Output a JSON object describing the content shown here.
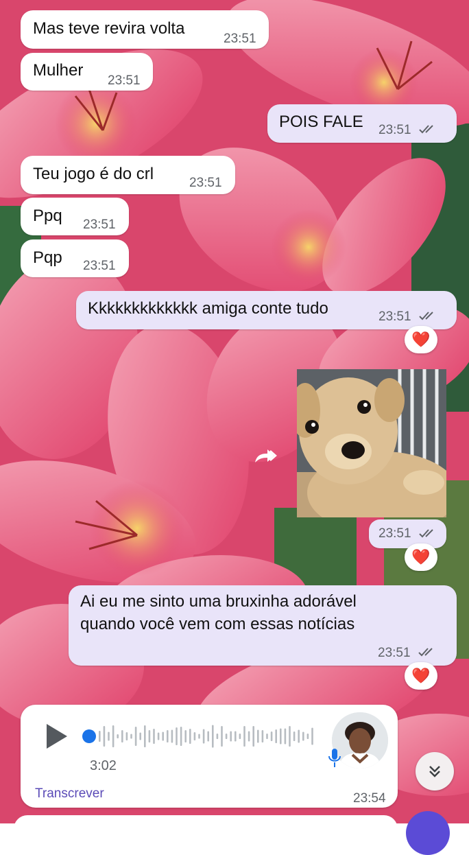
{
  "messages": [
    {
      "text": "Mas teve revira volta",
      "time": "23:51"
    },
    {
      "text": "Mulher",
      "time": "23:51"
    },
    {
      "text": "POIS FALE",
      "time": "23:51"
    },
    {
      "text": "Teu jogo é do crl",
      "time": "23:51"
    },
    {
      "text": "Ppq",
      "time": "23:51"
    },
    {
      "text": "Pqp",
      "time": "23:51"
    },
    {
      "text": "Kkkkkkkkkkkkk amiga conte tudo",
      "time": "23:51"
    },
    {
      "time": "23:51"
    },
    {
      "line1": "Ai eu me sinto uma bruxinha adorável",
      "line2": "quando você vem com essas notícias",
      "time": "23:51"
    }
  ],
  "reaction": "❤️",
  "voice": {
    "duration": "3:02",
    "transcribe_label": "Transcrever",
    "time": "23:54",
    "progress": 0
  },
  "icons": {
    "forward": "forward-icon",
    "play": "play-icon",
    "mic": "mic-icon",
    "scroll": "double-chevron-down-icon",
    "read": "double-check-icon"
  },
  "colors": {
    "outgoing": "#e9e4f9",
    "incoming": "#ffffff",
    "accent": "#1a73e8",
    "heart": "#e3262f",
    "link": "#5b4bb7"
  }
}
